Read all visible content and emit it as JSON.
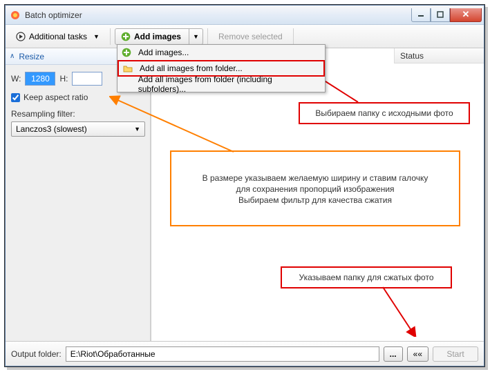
{
  "window": {
    "title": "Batch optimizer"
  },
  "toolbar": {
    "additional_tasks": "Additional tasks",
    "add_images": "Add images",
    "remove_selected": "Remove selected"
  },
  "sidebar": {
    "panel_title": "Resize",
    "w_label": "W:",
    "w_value": "1280",
    "h_label": "H:",
    "h_value": "",
    "keep_aspect": "Keep aspect ratio",
    "resampling_label": "Resampling filter:",
    "resampling_value": "Lanczos3 (slowest)"
  },
  "columns": {
    "status": "Status"
  },
  "menu": {
    "items": [
      "Add images...",
      "Add all images from folder...",
      "Add all images from folder (including subfolders)..."
    ]
  },
  "callouts": {
    "c1": "Выбираем папку с исходными фото",
    "c2_l1": "В размере указываем желаемую ширину и ставим галочку",
    "c2_l2": "для сохранения пропорций изображения",
    "c2_l3": "Выбираем фильтр для качества сжатия",
    "c3": "Указываем папку для сжатых фото"
  },
  "bottom": {
    "output_label": "Output folder:",
    "output_path": "E:\\Riot\\Обработанные",
    "browse": "...",
    "back": "««",
    "start": "Start"
  }
}
